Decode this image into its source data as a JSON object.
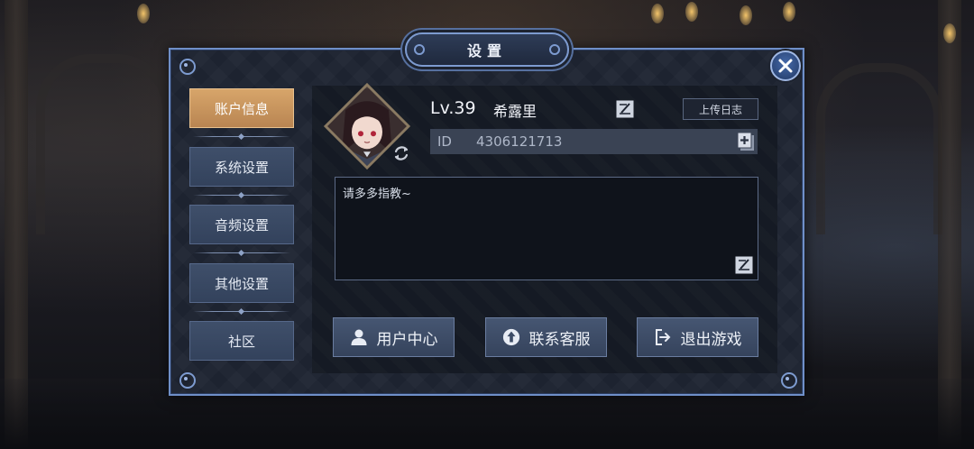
{
  "dialog": {
    "title": "设置"
  },
  "nav": {
    "items": [
      {
        "label": "账户信息",
        "active": true
      },
      {
        "label": "系统设置",
        "active": false
      },
      {
        "label": "音频设置",
        "active": false
      },
      {
        "label": "其他设置",
        "active": false
      },
      {
        "label": "社区",
        "active": false
      }
    ]
  },
  "profile": {
    "level": "Lv.39",
    "name": "希露里",
    "upload_log_label": "上传日志",
    "id_label": "ID",
    "id_value": "4306121713",
    "signature": "请多多指教~"
  },
  "actions": {
    "user_center": "用户中心",
    "contact_service": "联系客服",
    "exit_game": "退出游戏"
  },
  "icons": {
    "close": "close-icon",
    "refresh_avatar": "refresh-icon",
    "edit_name": "edit-icon",
    "copy_id": "copy-icon",
    "edit_signature": "edit-icon",
    "user": "user-icon",
    "service": "headset-icon",
    "exit": "exit-icon"
  },
  "colors": {
    "accent_active_tab": "#c9955e",
    "panel_border": "#6f8fc8",
    "button": "#3d4c66"
  }
}
